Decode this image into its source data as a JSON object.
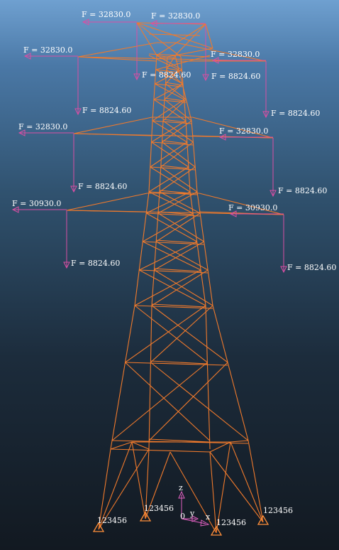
{
  "viewport": {
    "name": "model-viewport",
    "colors": {
      "member": "#f07a2c",
      "load": "#d94fa4",
      "support": "#ff8f3a",
      "label": "#ffffff",
      "axis": "#e060c0"
    }
  },
  "loads": {
    "horizontal": [
      {
        "label": "F = 32830.0"
      },
      {
        "label": "F = 32830.0"
      },
      {
        "label": "F = 32830.0"
      },
      {
        "label": "F = 32830.0"
      },
      {
        "label": "F = 32830.0"
      },
      {
        "label": "F = 32830.0"
      },
      {
        "label": "F = 30930.0"
      },
      {
        "label": "F = 30930.0"
      }
    ],
    "vertical": [
      {
        "label": "F = 8824.60"
      },
      {
        "label": "F = 8824.60"
      },
      {
        "label": "F = 8824.60"
      },
      {
        "label": "F = 8824.60"
      },
      {
        "label": "F = 8824.60"
      },
      {
        "label": "F = 8824.60"
      },
      {
        "label": "F = 8824.60"
      },
      {
        "label": "F = 8824.60"
      }
    ]
  },
  "supports": [
    {
      "label": "123456"
    },
    {
      "label": "123456"
    },
    {
      "label": "123456"
    },
    {
      "label": "123456"
    }
  ],
  "triad": {
    "z": "z",
    "y": "y",
    "x": "x",
    "origin": "0"
  }
}
